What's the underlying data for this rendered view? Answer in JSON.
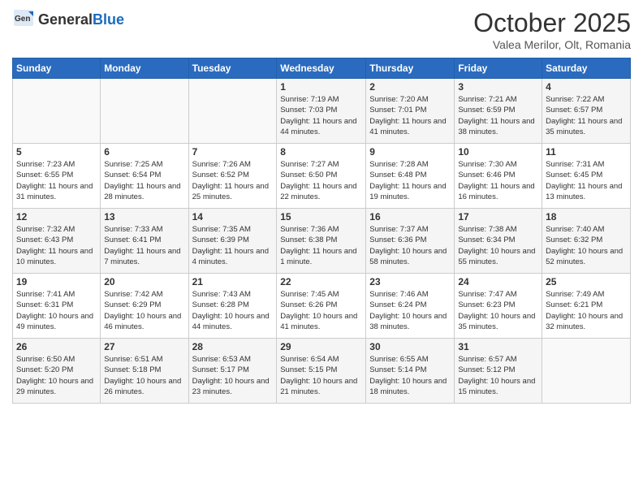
{
  "header": {
    "logo_general": "General",
    "logo_blue": "Blue",
    "month_title": "October 2025",
    "subtitle": "Valea Merilor, Olt, Romania"
  },
  "weekdays": [
    "Sunday",
    "Monday",
    "Tuesday",
    "Wednesday",
    "Thursday",
    "Friday",
    "Saturday"
  ],
  "weeks": [
    [
      {
        "day": "",
        "info": ""
      },
      {
        "day": "",
        "info": ""
      },
      {
        "day": "",
        "info": ""
      },
      {
        "day": "1",
        "info": "Sunrise: 7:19 AM\nSunset: 7:03 PM\nDaylight: 11 hours and 44 minutes."
      },
      {
        "day": "2",
        "info": "Sunrise: 7:20 AM\nSunset: 7:01 PM\nDaylight: 11 hours and 41 minutes."
      },
      {
        "day": "3",
        "info": "Sunrise: 7:21 AM\nSunset: 6:59 PM\nDaylight: 11 hours and 38 minutes."
      },
      {
        "day": "4",
        "info": "Sunrise: 7:22 AM\nSunset: 6:57 PM\nDaylight: 11 hours and 35 minutes."
      }
    ],
    [
      {
        "day": "5",
        "info": "Sunrise: 7:23 AM\nSunset: 6:55 PM\nDaylight: 11 hours and 31 minutes."
      },
      {
        "day": "6",
        "info": "Sunrise: 7:25 AM\nSunset: 6:54 PM\nDaylight: 11 hours and 28 minutes."
      },
      {
        "day": "7",
        "info": "Sunrise: 7:26 AM\nSunset: 6:52 PM\nDaylight: 11 hours and 25 minutes."
      },
      {
        "day": "8",
        "info": "Sunrise: 7:27 AM\nSunset: 6:50 PM\nDaylight: 11 hours and 22 minutes."
      },
      {
        "day": "9",
        "info": "Sunrise: 7:28 AM\nSunset: 6:48 PM\nDaylight: 11 hours and 19 minutes."
      },
      {
        "day": "10",
        "info": "Sunrise: 7:30 AM\nSunset: 6:46 PM\nDaylight: 11 hours and 16 minutes."
      },
      {
        "day": "11",
        "info": "Sunrise: 7:31 AM\nSunset: 6:45 PM\nDaylight: 11 hours and 13 minutes."
      }
    ],
    [
      {
        "day": "12",
        "info": "Sunrise: 7:32 AM\nSunset: 6:43 PM\nDaylight: 11 hours and 10 minutes."
      },
      {
        "day": "13",
        "info": "Sunrise: 7:33 AM\nSunset: 6:41 PM\nDaylight: 11 hours and 7 minutes."
      },
      {
        "day": "14",
        "info": "Sunrise: 7:35 AM\nSunset: 6:39 PM\nDaylight: 11 hours and 4 minutes."
      },
      {
        "day": "15",
        "info": "Sunrise: 7:36 AM\nSunset: 6:38 PM\nDaylight: 11 hours and 1 minute."
      },
      {
        "day": "16",
        "info": "Sunrise: 7:37 AM\nSunset: 6:36 PM\nDaylight: 10 hours and 58 minutes."
      },
      {
        "day": "17",
        "info": "Sunrise: 7:38 AM\nSunset: 6:34 PM\nDaylight: 10 hours and 55 minutes."
      },
      {
        "day": "18",
        "info": "Sunrise: 7:40 AM\nSunset: 6:32 PM\nDaylight: 10 hours and 52 minutes."
      }
    ],
    [
      {
        "day": "19",
        "info": "Sunrise: 7:41 AM\nSunset: 6:31 PM\nDaylight: 10 hours and 49 minutes."
      },
      {
        "day": "20",
        "info": "Sunrise: 7:42 AM\nSunset: 6:29 PM\nDaylight: 10 hours and 46 minutes."
      },
      {
        "day": "21",
        "info": "Sunrise: 7:43 AM\nSunset: 6:28 PM\nDaylight: 10 hours and 44 minutes."
      },
      {
        "day": "22",
        "info": "Sunrise: 7:45 AM\nSunset: 6:26 PM\nDaylight: 10 hours and 41 minutes."
      },
      {
        "day": "23",
        "info": "Sunrise: 7:46 AM\nSunset: 6:24 PM\nDaylight: 10 hours and 38 minutes."
      },
      {
        "day": "24",
        "info": "Sunrise: 7:47 AM\nSunset: 6:23 PM\nDaylight: 10 hours and 35 minutes."
      },
      {
        "day": "25",
        "info": "Sunrise: 7:49 AM\nSunset: 6:21 PM\nDaylight: 10 hours and 32 minutes."
      }
    ],
    [
      {
        "day": "26",
        "info": "Sunrise: 6:50 AM\nSunset: 5:20 PM\nDaylight: 10 hours and 29 minutes."
      },
      {
        "day": "27",
        "info": "Sunrise: 6:51 AM\nSunset: 5:18 PM\nDaylight: 10 hours and 26 minutes."
      },
      {
        "day": "28",
        "info": "Sunrise: 6:53 AM\nSunset: 5:17 PM\nDaylight: 10 hours and 23 minutes."
      },
      {
        "day": "29",
        "info": "Sunrise: 6:54 AM\nSunset: 5:15 PM\nDaylight: 10 hours and 21 minutes."
      },
      {
        "day": "30",
        "info": "Sunrise: 6:55 AM\nSunset: 5:14 PM\nDaylight: 10 hours and 18 minutes."
      },
      {
        "day": "31",
        "info": "Sunrise: 6:57 AM\nSunset: 5:12 PM\nDaylight: 10 hours and 15 minutes."
      },
      {
        "day": "",
        "info": ""
      }
    ]
  ]
}
